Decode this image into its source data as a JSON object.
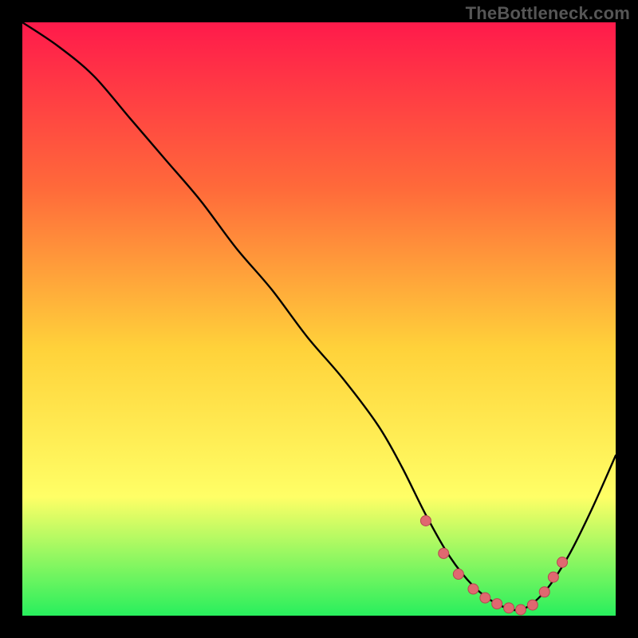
{
  "meta": {
    "watermark": "TheBottleneck.com"
  },
  "colors": {
    "background": "#000000",
    "gradient_top": "#ff1a4b",
    "gradient_mid1": "#ff6a3a",
    "gradient_mid2": "#ffd23a",
    "gradient_mid3": "#ffff66",
    "gradient_bottom": "#28ef5d",
    "curve": "#000000",
    "marker_fill": "#e06870",
    "marker_stroke": "#b54850",
    "watermark": "#565656"
  },
  "chart_data": {
    "type": "line",
    "title": "",
    "xlabel": "",
    "ylabel": "",
    "xlim": [
      0,
      100
    ],
    "ylim": [
      0,
      100
    ],
    "grid": false,
    "legend": false,
    "series": [
      {
        "name": "bottleneck-curve",
        "x": [
          0,
          6,
          12,
          18,
          24,
          30,
          36,
          42,
          48,
          54,
          60,
          64,
          68,
          72,
          76,
          80,
          84,
          88,
          92,
          96,
          100
        ],
        "y": [
          100,
          96,
          91,
          84,
          77,
          70,
          62,
          55,
          47,
          40,
          32,
          25,
          17,
          10,
          5,
          2,
          1,
          4,
          10,
          18,
          27
        ]
      }
    ],
    "markers": {
      "name": "trough-region",
      "x": [
        68,
        71,
        73.5,
        76,
        78,
        80,
        82,
        84,
        86,
        88,
        89.5,
        91
      ],
      "y": [
        16,
        10.5,
        7,
        4.5,
        3,
        2,
        1.3,
        1,
        1.8,
        4,
        6.5,
        9
      ]
    }
  }
}
